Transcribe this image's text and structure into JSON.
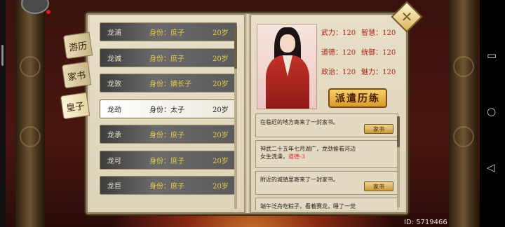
{
  "tabs": [
    {
      "label": "游历"
    },
    {
      "label": "家书"
    },
    {
      "label": "皇子"
    }
  ],
  "children": [
    {
      "name": "龙浦",
      "role": "身份：庶子",
      "age": "20岁"
    },
    {
      "name": "龙诚",
      "role": "身份：庶子",
      "age": "20岁"
    },
    {
      "name": "龙敦",
      "role": "身份：嫡长子",
      "age": "20岁"
    },
    {
      "name": "龙劲",
      "role": "身份：太子",
      "age": "20岁"
    },
    {
      "name": "龙承",
      "role": "身份：庶子",
      "age": "20岁"
    },
    {
      "name": "龙可",
      "role": "身份：庶子",
      "age": "20岁"
    },
    {
      "name": "龙巨",
      "role": "身份：庶子",
      "age": "20岁"
    }
  ],
  "stats": [
    [
      "武力：120",
      "智慧：120"
    ],
    [
      "道德：120",
      "统御：120"
    ],
    [
      "政治：120",
      "魅力：120"
    ]
  ],
  "dispatch_label": "派遣历练",
  "letters": [
    {
      "text": "在临近的地方寄来了一封家书。",
      "button": "家书"
    },
    {
      "text1": "神武二十五年七月湖广，龙劲偷看河边",
      "text2": "女生洗澡，",
      "text3": "道德-3"
    },
    {
      "text": "附近的城镇里寄来了一封家书。",
      "button": "家书"
    },
    {
      "text": "端午泛舟吃粽子，看着赛龙，睡了一觉"
    }
  ],
  "id_text": "ID: 5719466",
  "colors": {
    "accent": "#e6d04a",
    "stat": "#b0201a",
    "button": "#d79c2a"
  }
}
